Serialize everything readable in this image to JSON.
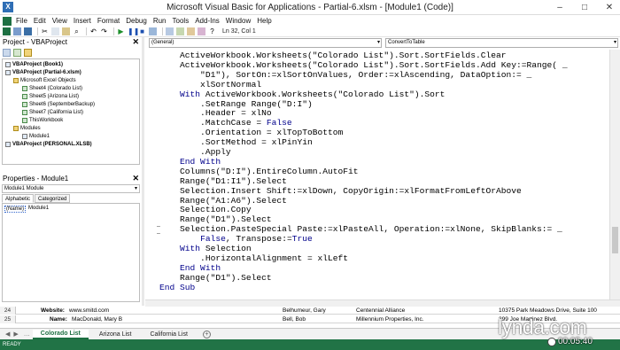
{
  "window": {
    "title": "Microsoft Visual Basic for Applications - Partial-6.xlsm - [Module1 (Code)]",
    "minimize": "–",
    "maximize": "□",
    "close": "✕"
  },
  "menu": [
    "File",
    "Edit",
    "View",
    "Insert",
    "Format",
    "Debug",
    "Run",
    "Tools",
    "Add-Ins",
    "Window",
    "Help"
  ],
  "toolbar": {
    "position": "Ln 32, Col 1"
  },
  "project_pane": {
    "title": "Project - VBAProject",
    "close": "✕",
    "tree": [
      "VBAProject (Book1)",
      "VBAProject (Partial-6.xlsm)",
      "Microsoft Excel Objects",
      "Sheet4 (Colorado List)",
      "Sheet5 (Arizona List)",
      "Sheet6 (SeptemberBackup)",
      "Sheet7 (California List)",
      "ThisWorkbook",
      "Modules",
      "Module1",
      "VBAProject (PERSONAL.XLSB)"
    ]
  },
  "properties_pane": {
    "title": "Properties - Module1",
    "close": "✕",
    "object": "Module1 Module",
    "tabs": [
      "Alphabetic",
      "Categorized"
    ],
    "prop_name": "(Name)",
    "prop_value": "Module1"
  },
  "code_window": {
    "object_combo": "(General)",
    "proc_combo": "ConvertToTable",
    "lines": [
      "    ActiveWorkbook.Worksheets(\"Colorado List\").Sort.SortFields.Clear",
      "    ActiveWorkbook.Worksheets(\"Colorado List\").Sort.SortFields.Add Key:=Range( _",
      "        \"D1\"), SortOn:=xlSortOnValues, Order:=xlAscending, DataOption:= _",
      "        xlSortNormal",
      "    With ActiveWorkbook.Worksheets(\"Colorado List\").Sort",
      "        .SetRange Range(\"D:I\")",
      "        .Header = xlNo",
      "        .MatchCase = False",
      "        .Orientation = xlTopToBottom",
      "        .SortMethod = xlPinYin",
      "        .Apply",
      "    End With",
      "    Columns(\"D:I\").EntireColumn.AutoFit",
      "    Range(\"D1:I1\").Select",
      "    Selection.Insert Shift:=xlDown, CopyOrigin:=xlFormatFromLeftOrAbove",
      "    Range(\"A1:A6\").Select",
      "    Selection.Copy",
      "    Range(\"D1\").Select",
      "    Selection.PasteSpecial Paste:=xlPasteAll, Operation:=xlNone, SkipBlanks:= _",
      "        False, Transpose:=True",
      "    With Selection",
      "        .HorizontalAlignment = xlLeft",
      "    End With",
      "    Range(\"D1\").Select",
      "End Sub"
    ]
  },
  "excel": {
    "rows": [
      {
        "num": "24",
        "a": "Website:",
        "b": "www.smitd.com",
        "c": "Belhumeur, Gary",
        "d": "Centennial Alliance",
        "e": "10375 Park Meadows Drive, Suite 100"
      },
      {
        "num": "25",
        "a": "Name:",
        "b": "MacDonald, Mary B",
        "c": "Bell, Bob",
        "d": "Millennium Properties, Inc.",
        "e": "299 Joe Martinez Blvd."
      }
    ],
    "sheet_tabs": [
      "Colorado List",
      "Arizona List",
      "California List"
    ],
    "status": "READY"
  },
  "watermark": {
    "brand": "lynda.com",
    "timecode": "00:05:40"
  }
}
